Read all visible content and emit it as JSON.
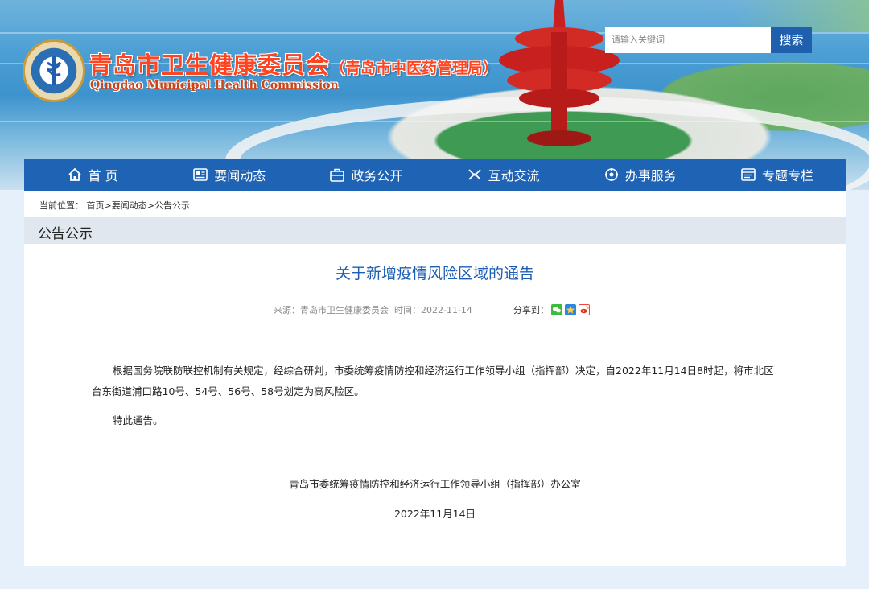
{
  "header": {
    "title": "青岛市卫生健康委员会",
    "subtitle": "（青岛市中医药管理局）",
    "title_en": "Qingdao Municipal Health Commission"
  },
  "search": {
    "placeholder": "请输入关键词",
    "button_label": "搜索"
  },
  "nav": {
    "items": [
      {
        "label": "首 页",
        "icon": "home-icon"
      },
      {
        "label": "要闻动态",
        "icon": "news-icon"
      },
      {
        "label": "政务公开",
        "icon": "briefcase-icon"
      },
      {
        "label": "互动交流",
        "icon": "interaction-icon"
      },
      {
        "label": "办事服务",
        "icon": "service-icon"
      },
      {
        "label": "专题专栏",
        "icon": "topic-icon"
      }
    ]
  },
  "breadcrumb": {
    "prefix": "当前位置：",
    "items": [
      "首页",
      "要闻动态",
      "公告公示"
    ],
    "separator": ">"
  },
  "section": {
    "title": "公告公示"
  },
  "article": {
    "title": "关于新增疫情风险区域的通告",
    "source_label": "来源：",
    "source": "青岛市卫生健康委员会",
    "time_label": "时间：",
    "time": "2022-11-14",
    "share_label": "分享到：",
    "paragraphs": [
      "根据国务院联防联控机制有关规定，经综合研判，市委统筹疫情防控和经济运行工作领导小组（指挥部）决定，自2022年11月14日8时起，将市北区台东街道浦口路10号、54号、56号、58号划定为高风险区。"
    ],
    "closing": "特此通告。",
    "signature": "青岛市委统筹疫情防控和经济运行工作领导小组（指挥部）办公室",
    "date": "2022年11月14日"
  },
  "colors": {
    "nav_bg": "#1e63b4",
    "title_blue": "#1d5eb4",
    "header_red": "#ff4422",
    "page_bg": "#e6f0fa"
  }
}
